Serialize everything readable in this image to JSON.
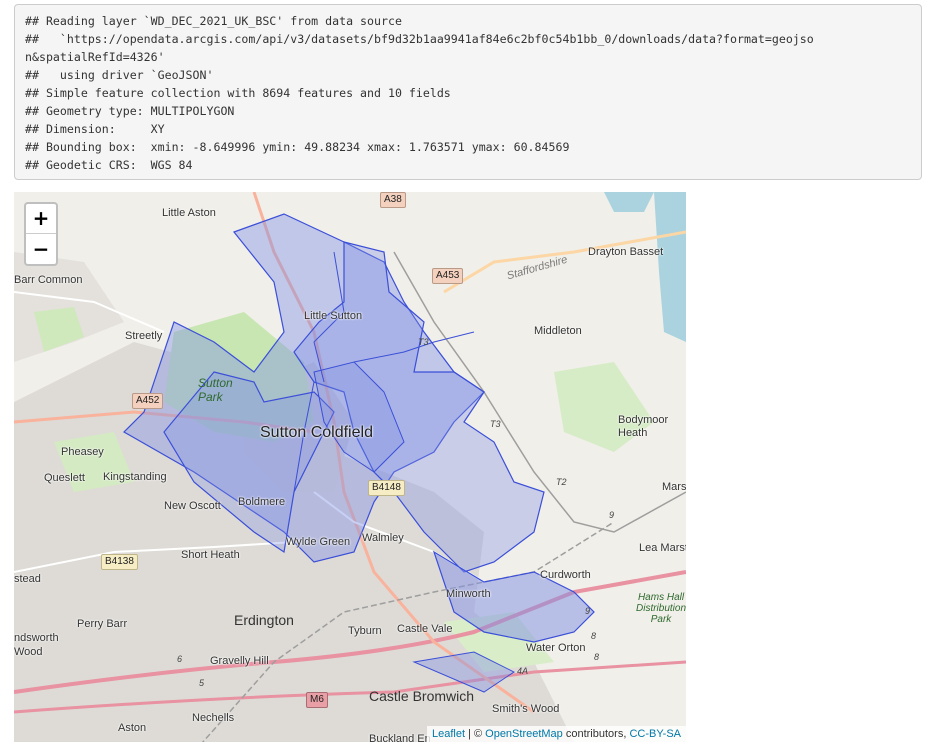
{
  "console": {
    "lines": [
      "## Reading layer `WD_DEC_2021_UK_BSC' from data source",
      "##   `https://opendata.arcgis.com/api/v3/datasets/bf9d32b1aa9941af84e6c2bf0c54b1bb_0/downloads/data?format=geojso",
      "n&spatialRefId=4326'",
      "##   using driver `GeoJSON'",
      "## Simple feature collection with 8694 features and 10 fields",
      "## Geometry type: MULTIPOLYGON",
      "## Dimension:     XY",
      "## Bounding box:  xmin: -8.649996 ymin: 49.88234 xmax: 1.763571 ymax: 60.84569",
      "## Geodetic CRS:  WGS 84"
    ]
  },
  "map": {
    "zoom_in_label": "+",
    "zoom_out_label": "−",
    "attribution": {
      "leaflet": "Leaflet",
      "sep": " | © ",
      "osm": "OpenStreetMap",
      "contributors": " contributors, ",
      "license": "CC-BY-SA"
    },
    "colors": {
      "polygon_fill": "#7f8fe6",
      "polygon_stroke": "#3b4fd8",
      "land": "#f1efe9",
      "park": "#c8e6b2",
      "urban": "#dedbd6"
    },
    "places": {
      "sutton_coldfield": "Sutton Coldfield",
      "erdington": "Erdington",
      "castle_bromwich": "Castle Bromwich",
      "little_sutton": "Little Sutton",
      "little_aston": "Little Aston",
      "barr_common": "Barr Common",
      "streetly": "Streetly",
      "pheasey": "Pheasey",
      "queslett": "Queslett",
      "kingstanding": "Kingstanding",
      "new_oscott": "New Oscott",
      "boldmere": "Boldmere",
      "short_heath": "Short Heath",
      "wylde_green": "Wylde Green",
      "walmley": "Walmley",
      "minworth": "Minworth",
      "middleton": "Middleton",
      "drayton_bassett": "Drayton Basset",
      "bodymoor_heath": "Bodymoor\nHeath",
      "marston": "Mars",
      "lea_marston": "Lea Marst",
      "curdworth": "Curdworth",
      "water_orton": "Water Orton",
      "castle_vale": "Castle Vale",
      "tyburn": "Tyburn",
      "gravelly_hill": "Gravelly Hill",
      "nechells": "Nechells",
      "aston": "Aston",
      "perry_barr": "Perry Barr",
      "handsworth": "ndsworth\nWood",
      "stead": "stead",
      "smiths_wood": "Smith's Wood",
      "buckland_end": "Buckland En",
      "sutton_park": "Sutton\nPark",
      "hams_hall": "Hams Hall\nDistribution\nPark",
      "staffordshire": "Staffordshire"
    },
    "roads": {
      "a38": "A38",
      "a453": "A453",
      "a452": "A452",
      "b4148": "B4148",
      "b4138": "B4138",
      "m6": "M6",
      "t3a": "T3",
      "t3b": "T3",
      "t2": "T2",
      "n9a": "9",
      "n9b": "9",
      "n8a": "8",
      "n8b": "8",
      "n6": "6",
      "n5": "5",
      "n4a": "4A"
    }
  }
}
